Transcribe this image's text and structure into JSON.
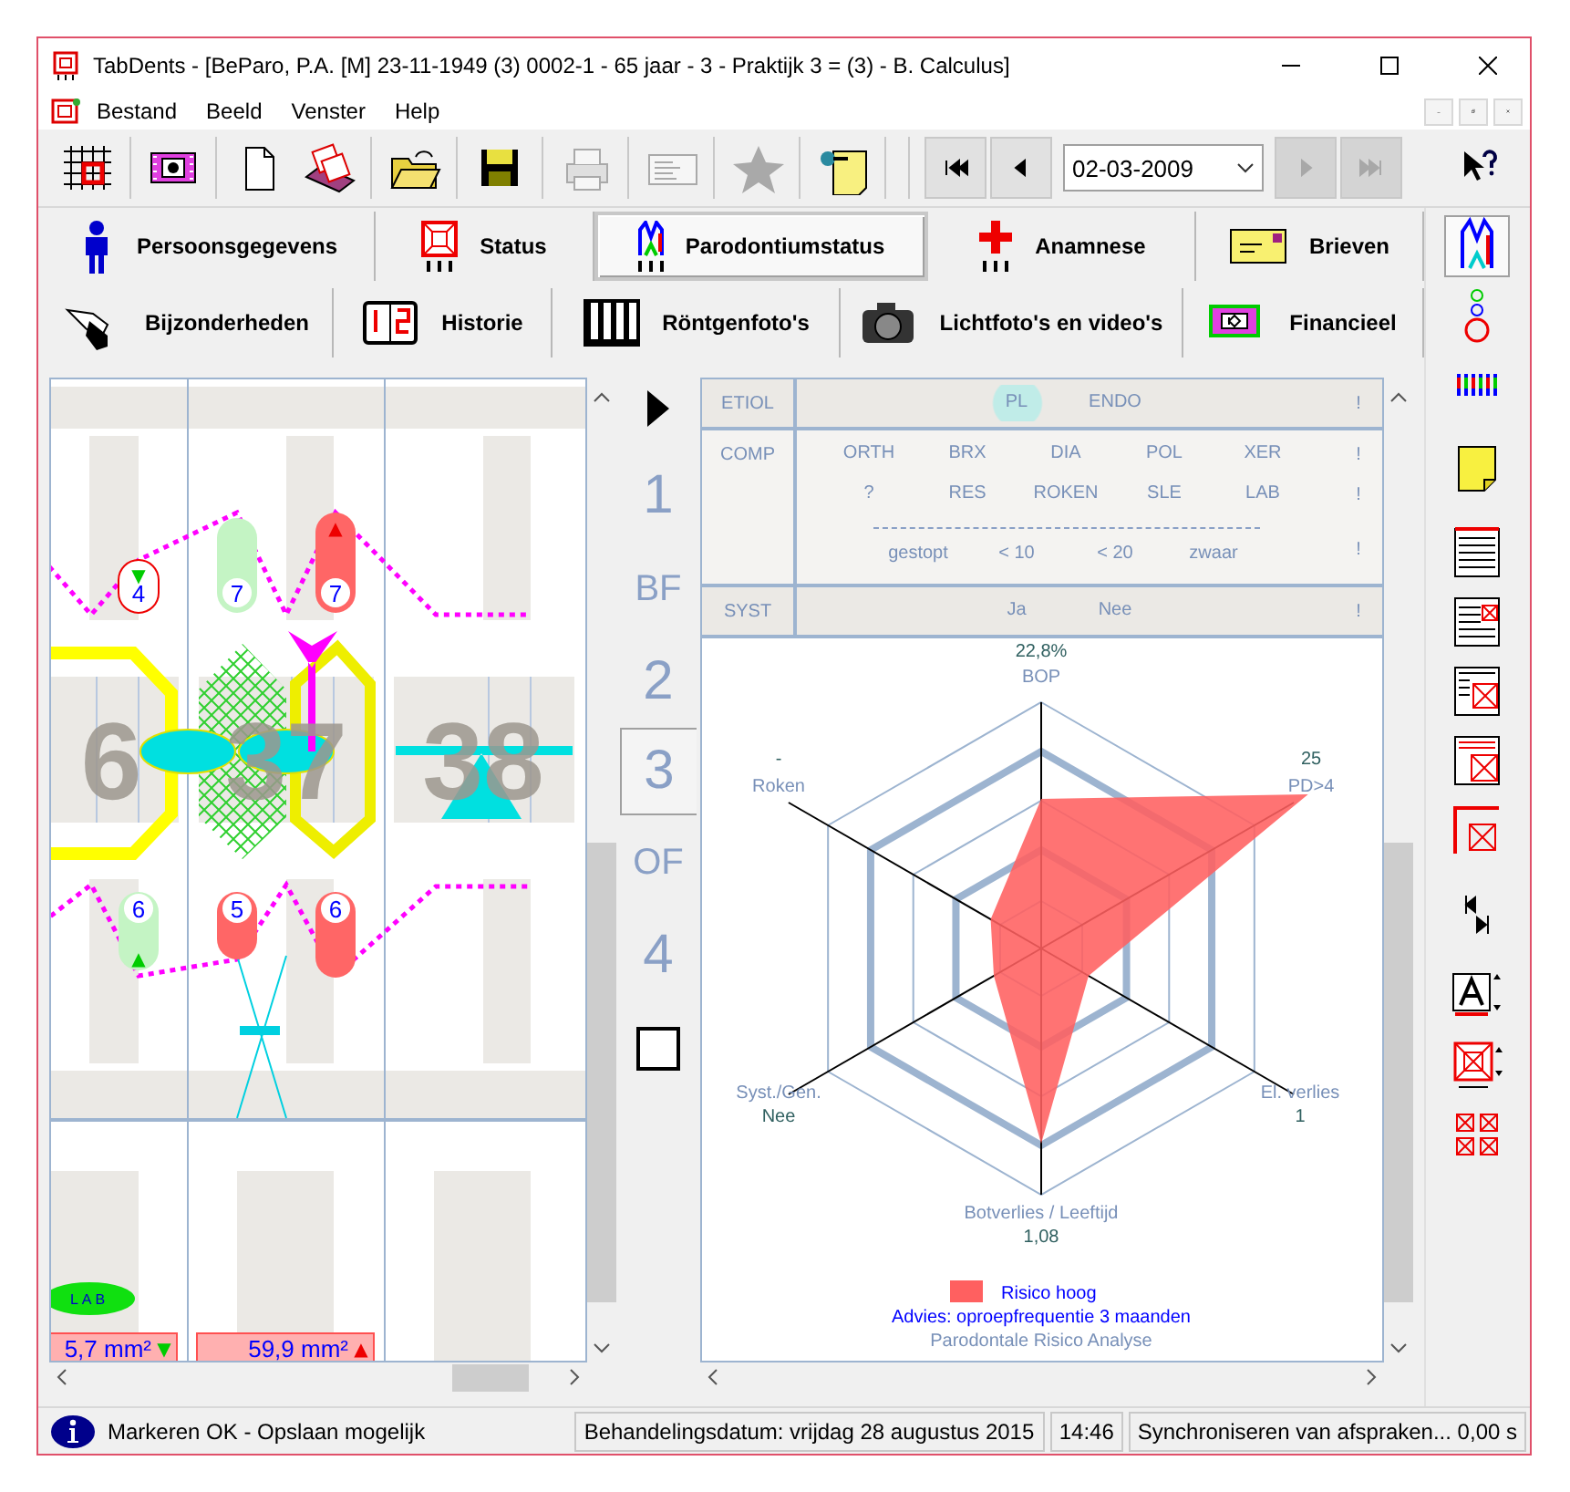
{
  "window": {
    "title": "TabDents - [BeParo, P.A. [M] 23-11-1949 (3) 0002-1 - 65 jaar - 3 - Praktijk 3 = (3) - B. Calculus]"
  },
  "menu": [
    "Bestand",
    "Beeld",
    "Venster",
    "Help"
  ],
  "toolbar": {
    "groups": [
      [
        {
          "kind": "grid",
          "disabled": false
        }
      ],
      [
        {
          "kind": "film",
          "disabled": false
        }
      ],
      [
        {
          "kind": "page",
          "disabled": false
        },
        {
          "kind": "cards",
          "disabled": false
        }
      ],
      [
        {
          "kind": "folder",
          "disabled": false
        }
      ],
      [
        {
          "kind": "save",
          "disabled": false
        }
      ],
      [
        {
          "kind": "print",
          "disabled": true
        }
      ],
      [
        {
          "kind": "card",
          "disabled": true
        }
      ],
      [
        {
          "kind": "star",
          "disabled": true
        }
      ],
      [
        {
          "kind": "note",
          "disabled": false
        }
      ]
    ],
    "nav": [
      {
        "kind": "first",
        "disabled": false
      },
      {
        "kind": "prev",
        "disabled": false
      },
      {
        "kind": "date",
        "value": "02-03-2009"
      },
      {
        "kind": "next",
        "disabled": true
      },
      {
        "kind": "last",
        "disabled": true
      }
    ]
  },
  "tabs": [
    [
      {
        "label": "Persoonsgegevens",
        "kind": "person",
        "selected": false
      },
      {
        "label": "Status",
        "kind": "status",
        "selected": false
      },
      {
        "label": "Parodontiumstatus",
        "kind": "paro",
        "selected": true
      },
      {
        "label": "Anamnese",
        "kind": "cross",
        "selected": false
      },
      {
        "label": "Brieven",
        "kind": "letter",
        "selected": false
      }
    ],
    [
      {
        "label": "Bijzonderheden",
        "kind": "hand",
        "selected": false
      },
      {
        "label": "Historie",
        "kind": "book",
        "selected": false
      },
      {
        "label": "Röntgenfoto's",
        "kind": "xray",
        "selected": false
      },
      {
        "label": "Lichtfoto's en video's",
        "kind": "camera",
        "selected": false
      },
      {
        "label": "Financieel",
        "kind": "money",
        "selected": false
      }
    ]
  ],
  "dental_chart": {
    "tooth_numbers": [
      "6",
      "37",
      "38"
    ],
    "upper_pockets": [
      {
        "value": "4",
        "color": "#ffffff",
        "trend": "▼"
      },
      {
        "value": "7",
        "color": "#c4f4c4"
      },
      {
        "value": "7",
        "color": "#ff6666",
        "trend": "▲"
      }
    ],
    "lower_pockets": [
      {
        "value": "6",
        "color": "#c4f4c4",
        "trend": "▲"
      },
      {
        "value": "5",
        "color": "#ff6666"
      },
      {
        "value": "6",
        "color": "#ff6666"
      }
    ],
    "lab": "LAB",
    "areas": [
      {
        "text": "5,7 mm²",
        "trend": "▼"
      },
      {
        "text": "59,9 mm²",
        "trend": "▲"
      }
    ]
  },
  "sextants": [
    {
      "label": "1",
      "selected": false
    },
    {
      "label": "BF",
      "selected": false
    },
    {
      "label": "2",
      "selected": false
    },
    {
      "label": "3",
      "selected": true
    },
    {
      "label": "OF",
      "selected": false
    },
    {
      "label": "4",
      "selected": false
    }
  ],
  "sextant_checkbox": {
    "checked": false
  },
  "risk_factors": [
    {
      "label": "ETIOL",
      "lines": [
        {
          "kind": "options",
          "items": [
            {
              "text": "PL",
              "selected": true
            },
            {
              "text": "ENDO",
              "selected": false
            }
          ],
          "flag": "!"
        }
      ]
    },
    {
      "label": "COMP",
      "lines": [
        {
          "kind": "options",
          "items": [
            {
              "text": "ORTH",
              "selected": false
            },
            {
              "text": "BRX",
              "selected": false
            },
            {
              "text": "DIA",
              "selected": false
            },
            {
              "text": "POL",
              "selected": false
            },
            {
              "text": "XER",
              "selected": false
            }
          ],
          "flag": "!"
        },
        {
          "kind": "options",
          "items": [
            {
              "text": "?",
              "selected": false
            },
            {
              "text": "RES",
              "selected": false
            },
            {
              "text": "ROKEN",
              "selected": false
            },
            {
              "text": "SLE",
              "selected": false
            },
            {
              "text": "LAB",
              "selected": false
            }
          ],
          "flag": "!"
        },
        {
          "kind": "sub",
          "items": [
            {
              "text": "gestopt",
              "selected": false
            },
            {
              "text": "< 10",
              "selected": false
            },
            {
              "text": "< 20",
              "selected": false
            },
            {
              "text": "zwaar",
              "selected": false
            }
          ],
          "flag": "!"
        }
      ]
    },
    {
      "label": "SYST",
      "lines": [
        {
          "kind": "options",
          "items": [
            {
              "text": "Ja",
              "selected": false
            },
            {
              "text": "Nee",
              "selected": false
            }
          ],
          "flag": "!"
        }
      ]
    }
  ],
  "risk_chart": {
    "axes": [
      {
        "label": "BOP",
        "value": "22,8%"
      },
      {
        "label": "Roken",
        "value": "-"
      },
      {
        "label": "PD>4",
        "value": "25"
      },
      {
        "label": "Syst./Gen.",
        "value": "Nee"
      },
      {
        "label": "El. verlies",
        "value": "1"
      },
      {
        "label": "Botverlies / Leeftijd",
        "value": "1,08"
      }
    ],
    "legend": {
      "label": "Risico hoog",
      "color": "#ff6060"
    },
    "advice": "Advies: oproepfrequentie 3 maanden",
    "title": "Parodontale Risico Analyse"
  },
  "side_tools": [
    {
      "kind": "paro",
      "selected": true
    },
    {
      "kind": "circles",
      "selected": false
    },
    {
      "kind": "teeth",
      "selected": false
    },
    {
      "kind": "note",
      "selected": false
    },
    {
      "kind": "list",
      "selected": false
    },
    {
      "kind": "listbox",
      "selected": false
    },
    {
      "kind": "listbox2",
      "selected": false
    },
    {
      "kind": "listbox3",
      "selected": false
    },
    {
      "kind": "corner",
      "selected": false
    },
    {
      "kind": "arrowbar",
      "selected": false
    },
    {
      "kind": "font",
      "selected": false
    },
    {
      "kind": "boxspin",
      "selected": false
    },
    {
      "kind": "crosses",
      "selected": false
    }
  ],
  "status_bar": [
    "Markeren OK - Opslaan mogelijk",
    "Behandelingsdatum: vrijdag 28 augustus 2015",
    "14:46",
    "Synchroniseren van afspraken... 0,00 s"
  ]
}
